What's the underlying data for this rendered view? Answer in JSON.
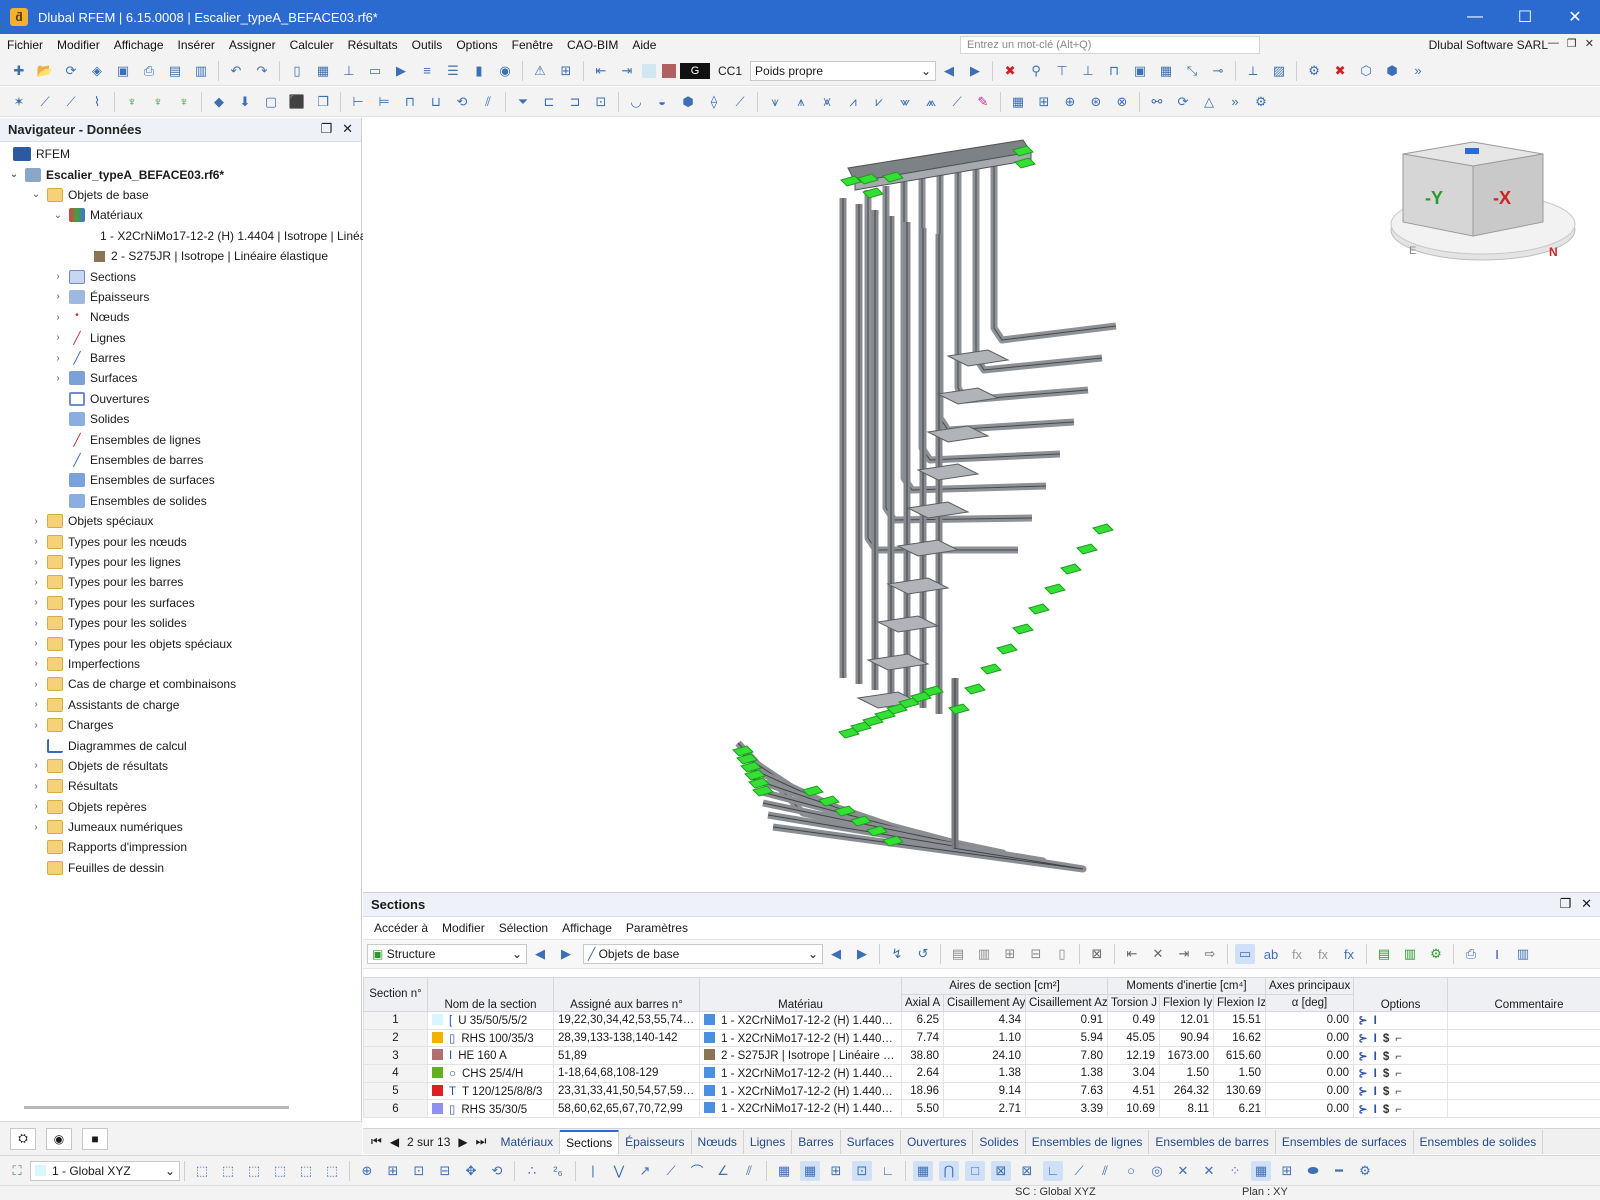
{
  "window": {
    "title": "Dlubal RFEM | 6.15.0008 | Escalier_typeA_BEFACE03.rf6*"
  },
  "menu": {
    "items": [
      "Fichier",
      "Modifier",
      "Affichage",
      "Insérer",
      "Assigner",
      "Calculer",
      "Résultats",
      "Outils",
      "Options",
      "Fenêtre",
      "CAO-BIM",
      "Aide"
    ],
    "search_placeholder": "Entrez un mot-clé (Alt+Q)",
    "company": "Dlubal Software SARL"
  },
  "toolbar": {
    "loadcase_color": "G",
    "loadcase_id": "CC1",
    "loadcase_name": "Poids propre"
  },
  "navigator": {
    "title": "Navigateur - Données",
    "root": "RFEM",
    "file": "Escalier_typeA_BEFACE03.rf6*",
    "base_objects": "Objets de base",
    "materials_label": "Matériaux",
    "materials": [
      "1 - X2CrNiMo17-12-2 (H) 1.4404 | Isotrope | Linéaire élastique",
      "2 - S275JR | Isotrope | Linéaire élastique"
    ],
    "base_children": [
      "Sections",
      "Épaisseurs",
      "Nœuds",
      "Lignes",
      "Barres",
      "Surfaces",
      "Ouvertures",
      "Solides",
      "Ensembles de lignes",
      "Ensembles de barres",
      "Ensembles de surfaces",
      "Ensembles de solides"
    ],
    "groups": [
      "Objets spéciaux",
      "Types pour les nœuds",
      "Types pour les lignes",
      "Types pour les barres",
      "Types pour les surfaces",
      "Types pour les solides",
      "Types pour les objets spéciaux",
      "Imperfections",
      "Cas de charge et combinaisons",
      "Assistants de charge",
      "Charges",
      "Diagrammes de calcul",
      "Objets de résultats",
      "Résultats",
      "Objets repères",
      "Jumeaux numériques",
      "Rapports d'impression",
      "Feuilles de dessin"
    ]
  },
  "viewcube": {
    "face_left": "-Y",
    "face_right": "-X",
    "ring_e": "E",
    "ring_n": "N"
  },
  "panel": {
    "title": "Sections",
    "menu": [
      "Accéder à",
      "Modifier",
      "Sélection",
      "Affichage",
      "Paramètres"
    ],
    "combo1": "Structure",
    "combo2": "Objets de base",
    "headers": {
      "section_no": "Section n°",
      "name": "Nom de la section",
      "assigned": "Assigné aux barres n°",
      "material": "Matériau",
      "areas_group": "Aires de section [cm²]",
      "axial": "Axial A",
      "shear_y": "Cisaillement Ay",
      "shear_z": "Cisaillement Az",
      "inertia_group": "Moments d'inertie [cm⁴]",
      "torsion": "Torsion J",
      "flex_y": "Flexion Iy",
      "flex_z": "Flexion Iz",
      "axes_group": "Axes principaux",
      "alpha": "α [deg]",
      "options": "Options",
      "comment": "Commentaire"
    },
    "rows": [
      {
        "no": "1",
        "color": "#d8f6ff",
        "shape": "[",
        "name": "U 35/50/5/5/2",
        "bars": "19,22,30,34,42,53,55,74,7...",
        "mat_color": "#4a90e2",
        "material": "1 - X2CrNiMo17-12-2 (H) 1.4404...",
        "A": "6.25",
        "Ay": "4.34",
        "Az": "0.91",
        "J": "0.49",
        "Iy": "12.01",
        "Iz": "15.51",
        "alpha": "0.00"
      },
      {
        "no": "2",
        "color": "#f2b300",
        "shape": "▯",
        "name": "RHS 100/35/3",
        "bars": "28,39,133-138,140-142",
        "mat_color": "#4a90e2",
        "material": "1 - X2CrNiMo17-12-2 (H) 1.4404...",
        "A": "7.74",
        "Ay": "1.10",
        "Az": "5.94",
        "J": "45.05",
        "Iy": "90.94",
        "Iz": "16.62",
        "alpha": "0.00"
      },
      {
        "no": "3",
        "color": "#b07070",
        "shape": "I",
        "name": "HE 160 A",
        "bars": "51,89",
        "mat_color": "#8b7355",
        "material": "2 - S275JR | Isotrope | Linéaire él...",
        "A": "38.80",
        "Ay": "24.10",
        "Az": "7.80",
        "J": "12.19",
        "Iy": "1673.00",
        "Iz": "615.60",
        "alpha": "0.00"
      },
      {
        "no": "4",
        "color": "#60b020",
        "shape": "○",
        "name": "CHS 25/4/H",
        "bars": "1-18,64,68,108-129",
        "mat_color": "#4a90e2",
        "material": "1 - X2CrNiMo17-12-2 (H) 1.4404...",
        "A": "2.64",
        "Ay": "1.38",
        "Az": "1.38",
        "J": "3.04",
        "Iy": "1.50",
        "Iz": "1.50",
        "alpha": "0.00"
      },
      {
        "no": "5",
        "color": "#e02020",
        "shape": "T",
        "name": "T 120/125/8/8/3",
        "bars": "23,31,33,41,50,54,57,59,6...",
        "mat_color": "#4a90e2",
        "material": "1 - X2CrNiMo17-12-2 (H) 1.4404...",
        "A": "18.96",
        "Ay": "9.14",
        "Az": "7.63",
        "J": "4.51",
        "Iy": "264.32",
        "Iz": "130.69",
        "alpha": "0.00"
      },
      {
        "no": "6",
        "color": "#9090f0",
        "shape": "▯",
        "name": "RHS 35/30/5",
        "bars": "58,60,62,65,67,70,72,99",
        "mat_color": "#4a90e2",
        "material": "1 - X2CrNiMo17-12-2 (H) 1.4404...",
        "A": "5.50",
        "Ay": "2.71",
        "Az": "3.39",
        "J": "10.69",
        "Iy": "8.11",
        "Iz": "6.21",
        "alpha": "0.00"
      }
    ],
    "pager": "2 sur 13",
    "tabs": [
      "Matériaux",
      "Sections",
      "Épaisseurs",
      "Nœuds",
      "Lignes",
      "Barres",
      "Surfaces",
      "Ouvertures",
      "Solides",
      "Ensembles de lignes",
      "Ensembles de barres",
      "Ensembles de surfaces",
      "Ensembles de solides"
    ],
    "active_tab": "Sections"
  },
  "bottombar": {
    "coord_system": "1 - Global XYZ"
  },
  "status": {
    "sc": "SC : Global XYZ",
    "plan": "Plan : XY"
  }
}
